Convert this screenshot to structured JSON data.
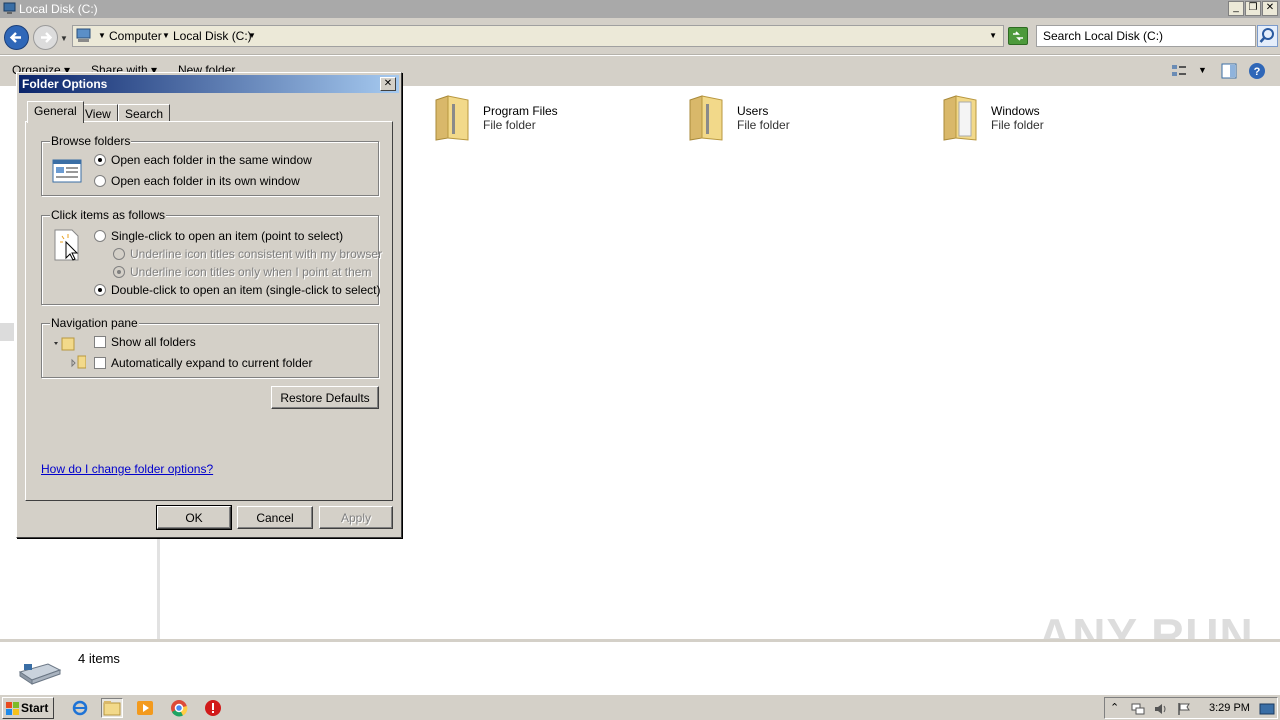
{
  "window": {
    "title": "Local Disk (C:)",
    "minimize_label": "_",
    "maximize_label": "❐",
    "close_label": "✕"
  },
  "address": {
    "crumbs": [
      "Computer",
      "Local Disk (C:)"
    ],
    "search_placeholder": "Search Local Disk (C:)"
  },
  "toolbar": {
    "organize_label": "Organize",
    "share_label": "Share with",
    "new_folder_label": "New folder"
  },
  "folders": [
    {
      "name": "Program Files",
      "type": "File folder"
    },
    {
      "name": "Users",
      "type": "File folder"
    },
    {
      "name": "Windows",
      "type": "File folder"
    }
  ],
  "status": {
    "item_count": "4 items"
  },
  "watermark": "ANY RUN",
  "dialog": {
    "title": "Folder Options",
    "close_label": "✕",
    "tabs": [
      "General",
      "View",
      "Search"
    ],
    "browse_folders": {
      "legend": "Browse folders",
      "option_same": "Open each folder in the same window",
      "option_own": "Open each folder in its own window"
    },
    "click_items": {
      "legend": "Click items as follows",
      "option_single": "Single-click to open an item (point to select)",
      "option_underline_browser": "Underline icon titles consistent with my browser",
      "option_underline_point": "Underline icon titles only when I point at them",
      "option_double": "Double-click to open an item (single-click to select)"
    },
    "nav_pane": {
      "legend": "Navigation pane",
      "show_all": "Show all folders",
      "auto_expand": "Automatically expand to current folder"
    },
    "restore_defaults_label": "Restore Defaults",
    "help_link": "How do I change folder options?",
    "ok_label": "OK",
    "cancel_label": "Cancel",
    "apply_label": "Apply"
  },
  "taskbar": {
    "start_label": "Start",
    "clock": "3:29 PM"
  },
  "colors": {
    "dialog_title_start": "#0a246a",
    "dialog_title_end": "#a6caf0",
    "classic_face": "#d4d0c8",
    "link": "#0000cc"
  }
}
